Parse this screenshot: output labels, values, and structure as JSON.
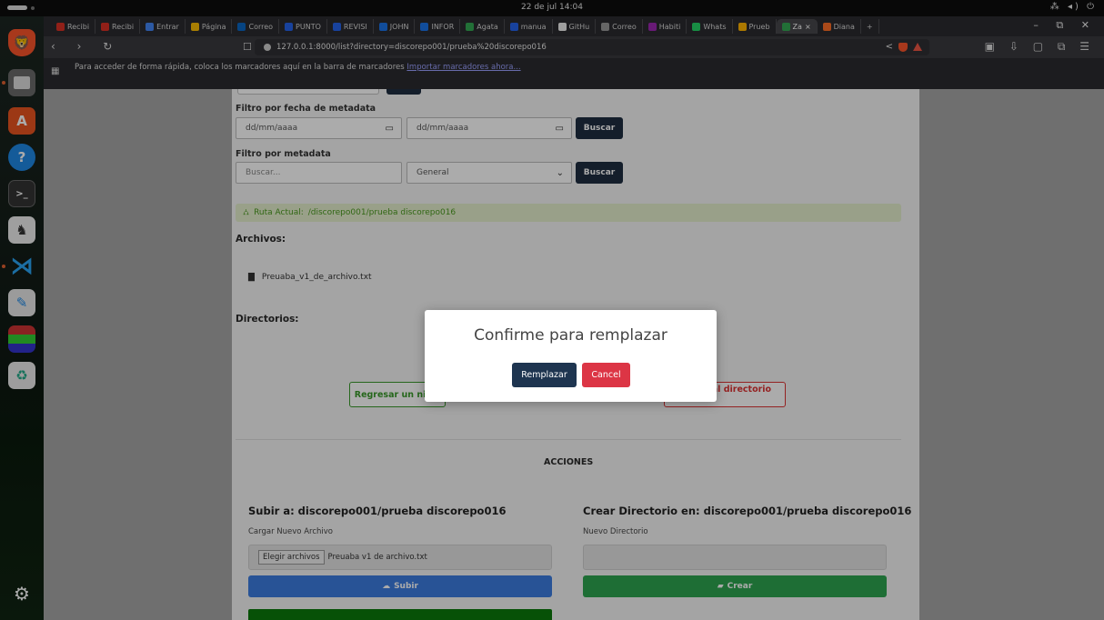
{
  "topbar": {
    "clock": "22 de jul  14:04",
    "sys_icons": "⁂ ◂) ⏻"
  },
  "dock": {
    "items": [
      "brave-browser",
      "files",
      "app-center",
      "help",
      "terminal",
      "app",
      "vscode",
      "text-editor",
      "archive-manager",
      "trash"
    ]
  },
  "browser": {
    "tabs": [
      {
        "label": "Recibi",
        "color": "#d93025"
      },
      {
        "label": "Recibi",
        "color": "#d93025"
      },
      {
        "label": "Entrar",
        "color": "#4285f4"
      },
      {
        "label": "Página",
        "color": "#fbbc04"
      },
      {
        "label": "Correo",
        "color": "#0a66c2"
      },
      {
        "label": "PUNTO",
        "color": "#2563eb"
      },
      {
        "label": "REVISI",
        "color": "#2563eb"
      },
      {
        "label": "JOHN",
        "color": "#1a73e8"
      },
      {
        "label": "INFOR",
        "color": "#1a73e8"
      },
      {
        "label": "Agata",
        "color": "#34a853"
      },
      {
        "label": "manua",
        "color": "#2563eb"
      },
      {
        "label": "GitHu",
        "color": "#eeeeee"
      },
      {
        "label": "Correo",
        "color": "#999999"
      },
      {
        "label": "Habiti",
        "color": "#9c27b0"
      },
      {
        "label": "Whats",
        "color": "#25d366"
      },
      {
        "label": "Prueb",
        "color": "#ffb300"
      },
      {
        "label": "Za",
        "color": "#34a853",
        "active": true
      },
      {
        "label": "Diana",
        "color": "#fc6d26"
      }
    ],
    "new_tab": "+",
    "window_controls": "– ⧉ ✕",
    "url": "127.0.0.1:8000/list?directory=discorepo001/prueba%20discorepo016",
    "bookmarks_msg": "Para acceder de forma rápida, coloca los marcadores aquí en la barra de marcadores",
    "bookmarks_link": "Importar marcadores ahora..."
  },
  "filters": {
    "date_label": "Filtro por fecha de metadata",
    "date_from": "dd/mm/aaaa",
    "date_to": "dd/mm/aaaa",
    "search_btn": "Buscar",
    "meta_label": "Filtro por metadata",
    "meta_placeholder": "Buscar...",
    "meta_select": "General",
    "search_btn2": "Buscar"
  },
  "route": {
    "label": "Ruta Actual:",
    "path": "/discorepo001/prueba discorepo016"
  },
  "files": {
    "heading": "Archivos:",
    "items": [
      "Preuaba_v1_de_archivo.txt"
    ]
  },
  "dirs": {
    "heading": "Directorios:",
    "back_btn": "Regresar un nivel",
    "root_btn": "Regresar al directorio raiz"
  },
  "actions": {
    "heading": "ACCIONES",
    "upload_title": "Subir a: discorepo001/prueba discorepo016",
    "upload_label": "Cargar Nuevo Archivo",
    "choose_btn": "Elegir archivos",
    "chosen_file": "Preuaba v1 de archivo.txt",
    "upload_btn": "Subir",
    "create_title": "Crear Directorio en: discorepo001/prueba discorepo016",
    "create_label": "Nuevo Directorio",
    "create_btn": "Crear"
  },
  "modal": {
    "title": "Confirme para remplazar",
    "confirm": "Remplazar",
    "cancel": "Cancel"
  }
}
